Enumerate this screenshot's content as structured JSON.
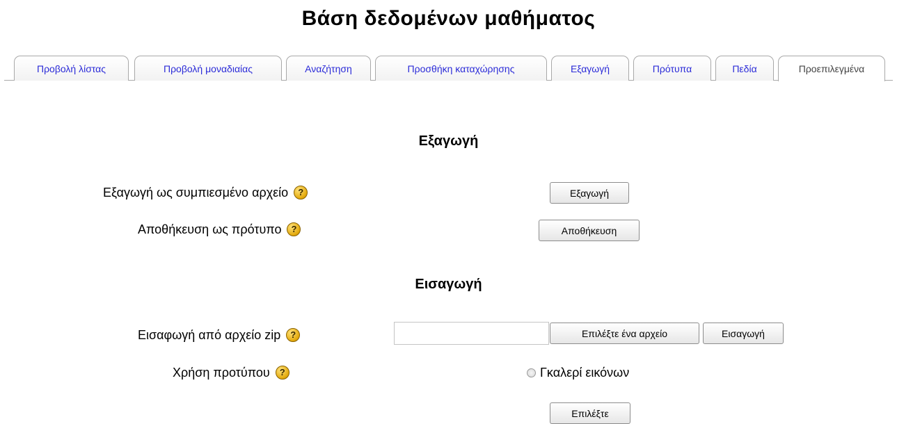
{
  "page": {
    "title": "Βάση δεδομένων μαθήματος"
  },
  "tabs": [
    {
      "label": "Προβολή λίστας",
      "active": false
    },
    {
      "label": "Προβολή μοναδιαίας",
      "active": false
    },
    {
      "label": "Αναζήτηση",
      "active": false
    },
    {
      "label": "Προσθήκη καταχώρησης",
      "active": false
    },
    {
      "label": "Εξαγωγή",
      "active": false
    },
    {
      "label": "Πρότυπα",
      "active": false
    },
    {
      "label": "Πεδία",
      "active": false
    },
    {
      "label": "Προεπιλεγμένα",
      "active": true
    }
  ],
  "export_section": {
    "heading": "Εξαγωγή",
    "export_zip": {
      "label": "Εξαγωγή ως συμπιεσμένο αρχείο",
      "button": "Εξαγωγή",
      "help_icon": "question-mark-icon"
    },
    "save_template": {
      "label": "Αποθήκευση ως πρότυπο",
      "button": "Αποθήκευση",
      "help_icon": "question-mark-icon"
    }
  },
  "import_section": {
    "heading": "Εισαγωγή",
    "import_zip": {
      "label": "Εισαφωγή από αρχείο zip",
      "file_value": "",
      "choose_button": "Επιλέξτε ένα αρχείο",
      "import_button": "Εισαγωγή",
      "help_icon": "question-mark-icon"
    },
    "use_template": {
      "label": "Χρήση προτύπου",
      "option": "Γκαλερί εικόνων",
      "option_selected": false,
      "select_button": "Επιλέξτε",
      "help_icon": "question-mark-icon"
    }
  },
  "colors": {
    "tab_link": "#2b2bd8",
    "tab_active_text": "#444444",
    "tab_border": "#a8a8a8",
    "help_icon": "#e3a90b"
  }
}
